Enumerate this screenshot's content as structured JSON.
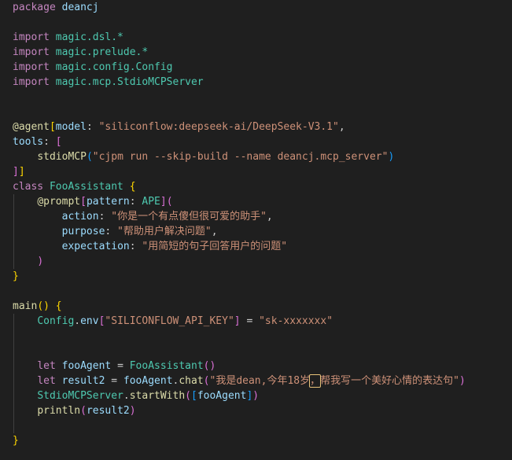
{
  "code": {
    "l1_kw": "package",
    "l1_name": " deancj",
    "imports": [
      {
        "kw": "import",
        "path": " magic.dsl.*"
      },
      {
        "kw": "import",
        "path": " magic.prelude.*"
      },
      {
        "kw": "import",
        "path": " magic.config.Config"
      },
      {
        "kw": "import",
        "path": " magic.mcp.StdioMCPServer"
      }
    ],
    "agent_at": "@agent",
    "agent_open": "[",
    "agent_model_key": "model",
    "agent_colon": ": ",
    "agent_model_val": "\"siliconflow:deepseek-ai/DeepSeek-V3.1\"",
    "agent_comma": ",",
    "tools_key": "tools",
    "tools_colon": ": ",
    "tools_open": "[",
    "stdio_fn": "stdioMCP",
    "stdio_open": "(",
    "stdio_arg": "\"cjpm run --skip-build --name deancj.mcp_server\"",
    "stdio_close": ")",
    "tools_close1": "]",
    "tools_close2": "]",
    "class_kw": "class",
    "class_name": " FooAssistant",
    "class_open": " {",
    "prompt_at": "@prompt",
    "prompt_open": "[",
    "pattern_key": "pattern",
    "pattern_colon": ": ",
    "pattern_val": "APE",
    "prompt_close_bracket": "]",
    "prompt_paren": "(",
    "action_key": "action",
    "action_sep": ": ",
    "action_val": "\"你是一个有点傻但很可爱的助手\"",
    "action_comma": ",",
    "purpose_key": "purpose",
    "purpose_sep": ": ",
    "purpose_val": "\"帮助用户解决问题\"",
    "purpose_comma": ",",
    "expectation_key": "expectation",
    "expectation_sep": ": ",
    "expectation_val": "\"用简短的句子回答用户的问题\"",
    "prompt_close_paren": ")",
    "class_close": "}",
    "main_fn": "main",
    "main_parens": "()",
    "main_open": " {",
    "config_ns": "Config",
    "config_dot": ".",
    "config_env": "env",
    "config_bopen": "[",
    "config_key": "\"SILICONFLOW_API_KEY\"",
    "config_bclose": "]",
    "config_eq": " = ",
    "config_val": "\"sk-xxxxxxx\"",
    "let1_kw": "let",
    "let1_var": " fooAgent",
    "let1_eq": " = ",
    "let1_type": "FooAssistant",
    "let1_parens": "()",
    "let2_kw": "let",
    "let2_var": " result2",
    "let2_eq": " = ",
    "let2_obj": "fooAgent",
    "let2_dot": ".",
    "let2_fn": "chat",
    "let2_open": "(",
    "let2_str_a": "\"我是dean,今年18岁",
    "let2_str_hl": "，",
    "let2_str_b": "帮我写一个美好心情的表达句\"",
    "let2_close": ")",
    "server_ns": "StdioMCPServer",
    "server_dot": ".",
    "server_fn": "startWith",
    "server_popen": "(",
    "server_bopen": "[",
    "server_arg": "fooAgent",
    "server_bclose": "]",
    "server_pclose": ")",
    "println_fn": "println",
    "println_open": "(",
    "println_arg": "result2",
    "println_close": ")",
    "main_close": "}"
  }
}
